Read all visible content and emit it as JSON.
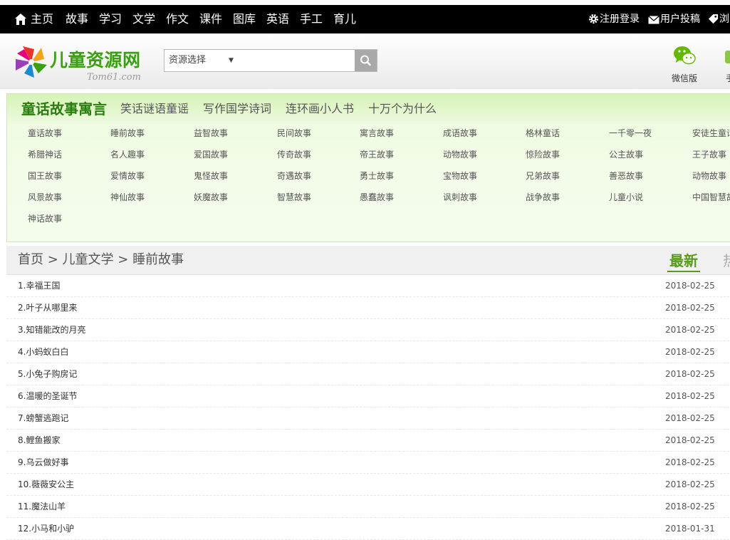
{
  "topnav": {
    "items": [
      "主页",
      "故事",
      "学习",
      "文学",
      "作文",
      "课件",
      "图库",
      "英语",
      "手工",
      "育儿"
    ],
    "register_label": "注册登录",
    "submit_label": "用户投稿",
    "browse_label": "浏"
  },
  "header": {
    "logo_text": "儿童资源网",
    "logo_sub": "Tom61.com",
    "search": {
      "select_label": "资源选择",
      "arrow": "▼",
      "value": ""
    },
    "wechat_label": "微信版",
    "phone_label": "手"
  },
  "categories": {
    "tabs": [
      "童话故事寓言",
      "笑话谜语童谣",
      "写作国学诗词",
      "连环画小人书",
      "十万个为什么"
    ],
    "links": [
      "童话故事",
      "睡前故事",
      "益智故事",
      "民间故事",
      "寓言故事",
      "成语故事",
      "格林童话",
      "一千零一夜",
      "安徒生童话",
      "希腊神话",
      "名人趣事",
      "爱国故事",
      "传奇故事",
      "帝王故事",
      "动物故事",
      "惊险故事",
      "公主故事",
      "王子故事",
      "国王故事",
      "爱情故事",
      "鬼怪故事",
      "奇遇故事",
      "勇士故事",
      "宝物故事",
      "兄弟故事",
      "善恶故事",
      "动物故事",
      "风景故事",
      "神仙故事",
      "妖魔故事",
      "智慧故事",
      "愚蠢故事",
      "讽刺故事",
      "战争故事",
      "儿童小说",
      "中国智慧故事",
      "神话故事"
    ]
  },
  "listing": {
    "breadcrumb": {
      "home": "首页",
      "sep": " > ",
      "level1": "儿童文学",
      "level2": "睡前故事"
    },
    "sort_new": "最新",
    "sort_hot": "热",
    "rows": [
      {
        "title": "1.幸福王国",
        "date": "2018-02-25"
      },
      {
        "title": "2.叶子从哪里来",
        "date": "2018-02-25"
      },
      {
        "title": "3.知错能改的月亮",
        "date": "2018-02-25"
      },
      {
        "title": "4.小蚂蚁白白",
        "date": "2018-02-25"
      },
      {
        "title": "5.小兔子购房记",
        "date": "2018-02-25"
      },
      {
        "title": "6.温暖的圣诞节",
        "date": "2018-02-25"
      },
      {
        "title": "7.螃蟹逃跑记",
        "date": "2018-02-25"
      },
      {
        "title": "8.鲤鱼搬家",
        "date": "2018-02-25"
      },
      {
        "title": "9.乌云做好事",
        "date": "2018-02-25"
      },
      {
        "title": "10.薇薇安公主",
        "date": "2018-02-25"
      },
      {
        "title": "11.魔法山羊",
        "date": "2018-02-25"
      },
      {
        "title": "12.小马和小驴",
        "date": "2018-01-31"
      }
    ]
  },
  "colors": {
    "nav_bg": "#000000",
    "brand_green": "#3aa010",
    "category_green": "#2a7d0e",
    "accent": "#5a9a1a"
  }
}
